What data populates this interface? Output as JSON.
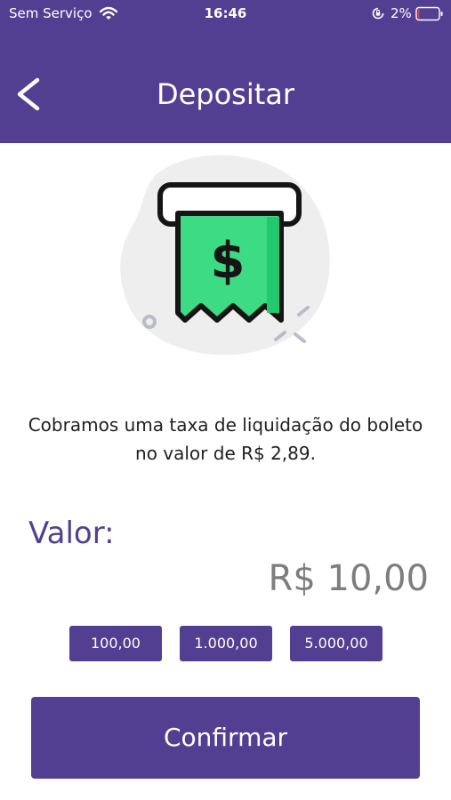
{
  "status_bar": {
    "carrier": "Sem Serviço",
    "time": "16:46",
    "battery": "2%",
    "wifi_icon": "wifi-icon",
    "lock_icon": "orientation-lock-icon",
    "battery_icon": "battery-icon"
  },
  "header": {
    "title": "Depositar",
    "back_icon": "chevron-left-icon",
    "background_color": "#533f91"
  },
  "illustration": {
    "icon": "receipt-dollar-icon",
    "accent_color": "#2ecc71"
  },
  "info_text": "Cobramos uma taxa de liquidação do boleto no valor de R$ 2,89.",
  "amount": {
    "label": "Valor:",
    "value": "R$ 10,00"
  },
  "quick_amounts": [
    "100,00",
    "1.000,00",
    "5.000,00"
  ],
  "confirm_label": "Confirmar"
}
